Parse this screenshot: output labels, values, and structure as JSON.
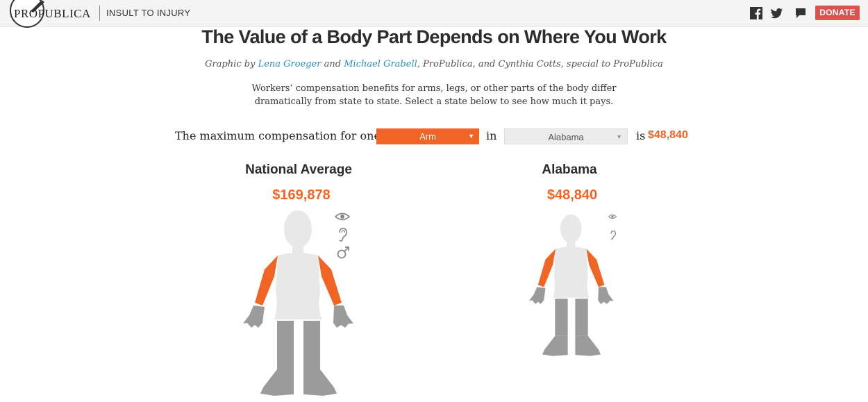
{
  "header": {
    "brand": "PROPUBLICA",
    "section": "INSULT TO INJURY",
    "donate_label": "DONATE",
    "social_icons": [
      "facebook-icon",
      "twitter-icon",
      "comment-icon"
    ]
  },
  "article": {
    "title": "The Value of a Body Part Depends on Where You Work",
    "byline_prefix": "Graphic by ",
    "author1": "Lena Groeger",
    "byline_and": " and ",
    "author2": "Michael Grabell",
    "byline_suffix": ", ProPublica, and Cynthia Cotts, special to ProPublica",
    "intro": "Workers’ compensation benefits for arms, legs, or other parts of the body differ dramatically from state to state. Select a state below to see how much it pays."
  },
  "selector": {
    "prefix": "The maximum compensation for one",
    "body_part": "Arm",
    "middle": "in",
    "state": "Alabama",
    "is_label": "is",
    "amount": "$48,840"
  },
  "comparison": {
    "national": {
      "title": "National Average",
      "amount": "$169,878",
      "icons": [
        "eye-icon",
        "ear-icon",
        "male-symbol-icon"
      ]
    },
    "state": {
      "title": "Alabama",
      "amount": "$48,840",
      "icons": [
        "eye-icon",
        "ear-icon"
      ],
      "relative_scale": 0.78
    }
  },
  "colors": {
    "accent": "#f16524",
    "body": "#e8e8e8",
    "limb": "#9b9b9b",
    "donate": "#d9534f",
    "link": "#2a8ec6"
  }
}
